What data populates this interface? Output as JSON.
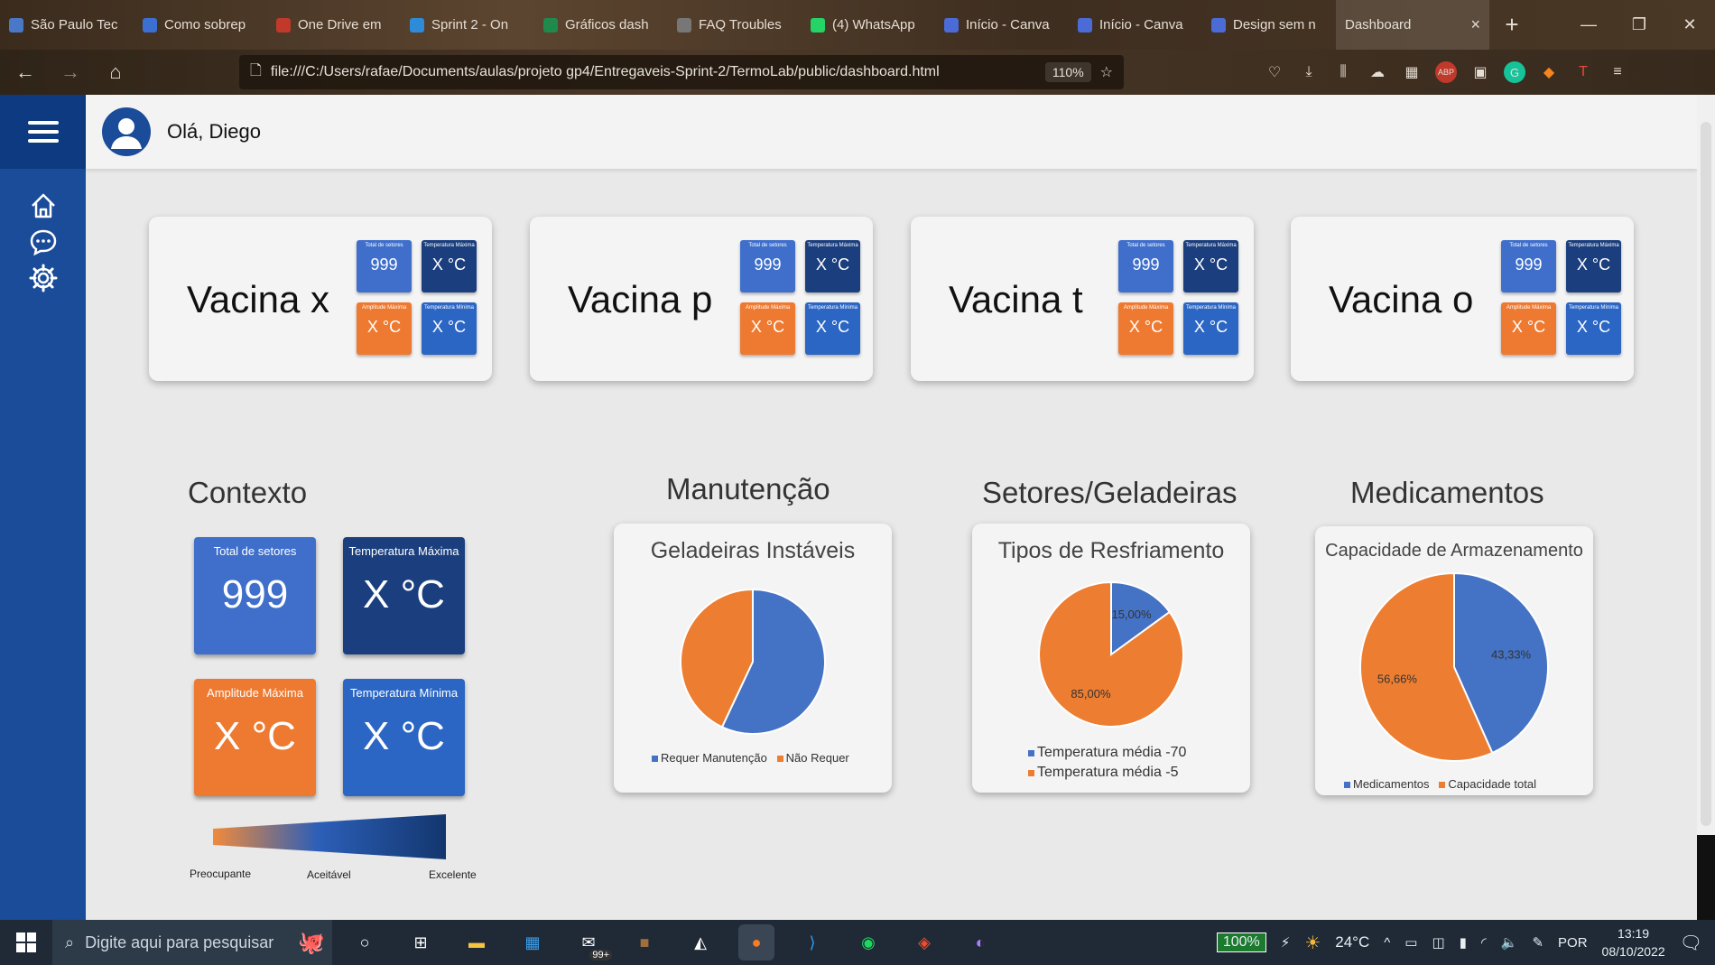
{
  "browser": {
    "tabs": [
      {
        "label": "São Paulo Tec",
        "color": "#4a78c8"
      },
      {
        "label": "Como sobrep",
        "color": "#3b6fd1"
      },
      {
        "label": "One Drive em",
        "color": "#c0392b"
      },
      {
        "label": "Sprint 2 - On",
        "color": "#2e8bd8"
      },
      {
        "label": "Gráficos dash",
        "color": "#1f8a4c"
      },
      {
        "label": "FAQ Troubles",
        "color": "#777777"
      },
      {
        "label": "(4) WhatsApp",
        "color": "#25d366"
      },
      {
        "label": "Início - Canva",
        "color": "#4b6bd6"
      },
      {
        "label": "Início - Canva",
        "color": "#4b6bd6"
      },
      {
        "label": "Design sem n",
        "color": "#4b6bd6"
      }
    ],
    "active_tab": "Dashboard",
    "url": "file:///C:/Users/rafae/Documents/aulas/projeto gp4/Entregaveis-Sprint-2/TermoLab/public/dashboard.html",
    "zoom": "110%"
  },
  "header": {
    "greeting": "Olá, Diego"
  },
  "vaccines": [
    {
      "name": "Vacina x",
      "tiles": [
        {
          "label": "Total de setores",
          "value": "999"
        },
        {
          "label": "Temperatura Máxima",
          "value": "X °C"
        },
        {
          "label": "Amplitude Máxima",
          "value": "X °C"
        },
        {
          "label": "Temperatura Mínima",
          "value": "X °C"
        }
      ]
    },
    {
      "name": "Vacina p",
      "tiles": [
        {
          "label": "Total de setores",
          "value": "999"
        },
        {
          "label": "Temperatura Máxima",
          "value": "X °C"
        },
        {
          "label": "Amplitude Máxima",
          "value": "X °C"
        },
        {
          "label": "Temperatura Mínima",
          "value": "X °C"
        }
      ]
    },
    {
      "name": "Vacina t",
      "tiles": [
        {
          "label": "Total de setores",
          "value": "999"
        },
        {
          "label": "Temperatura Máxima",
          "value": "X °C"
        },
        {
          "label": "Amplitude Máxima",
          "value": "X °C"
        },
        {
          "label": "Temperatura Mínima",
          "value": "X °C"
        }
      ]
    },
    {
      "name": "Vacina o",
      "tiles": [
        {
          "label": "Total de setores",
          "value": "999"
        },
        {
          "label": "Temperatura Máxima",
          "value": "X °C"
        },
        {
          "label": "Amplitude Máxima",
          "value": "X °C"
        },
        {
          "label": "Temperatura Mínima",
          "value": "X °C"
        }
      ]
    }
  ],
  "context": {
    "title": "Contexto",
    "tiles": [
      {
        "label": "Total de setores",
        "value": "999"
      },
      {
        "label": "Temperatura Máxima",
        "value": "X °C"
      },
      {
        "label": "Amplitude Máxima",
        "value": "X °C"
      },
      {
        "label": "Temperatura Mínima",
        "value": "X °C"
      }
    ],
    "scale": {
      "low": "Preocupante",
      "mid": "Aceitável",
      "high": "Excelente"
    }
  },
  "sections": {
    "maintenance": "Manutenção",
    "sectors": "Setores/Geladeiras",
    "medicines": "Medicamentos"
  },
  "colors": {
    "blue": "#4472c4",
    "orange": "#ed7d31",
    "navy": "#1b3f7e",
    "sidebar": "#1a4c9a"
  },
  "chart_data": [
    {
      "type": "pie",
      "title": "Geladeiras Instáveis",
      "labels": [
        "Requer Manutenção",
        "Não Requer"
      ],
      "values": [
        57,
        43
      ],
      "data_labels": [
        "",
        ""
      ]
    },
    {
      "type": "pie",
      "title": "Tipos de Resfriamento",
      "labels": [
        "Temperatura média -70",
        "Temperatura média -5"
      ],
      "values": [
        15,
        85
      ],
      "data_labels": [
        "15,00%",
        "85,00%"
      ]
    },
    {
      "type": "pie",
      "title": "Capacidade de Armazenamento",
      "labels": [
        "Medicamentos",
        "Capacidade total"
      ],
      "values": [
        43.33,
        56.66
      ],
      "data_labels": [
        "43,33%",
        "56,66%"
      ]
    }
  ],
  "taskbar": {
    "search_placeholder": "Digite aqui para pesquisar",
    "mail_badge": "99+",
    "battery": "100%",
    "weather": "24°C",
    "language": "POR",
    "time": "13:19",
    "date": "08/10/2022"
  }
}
